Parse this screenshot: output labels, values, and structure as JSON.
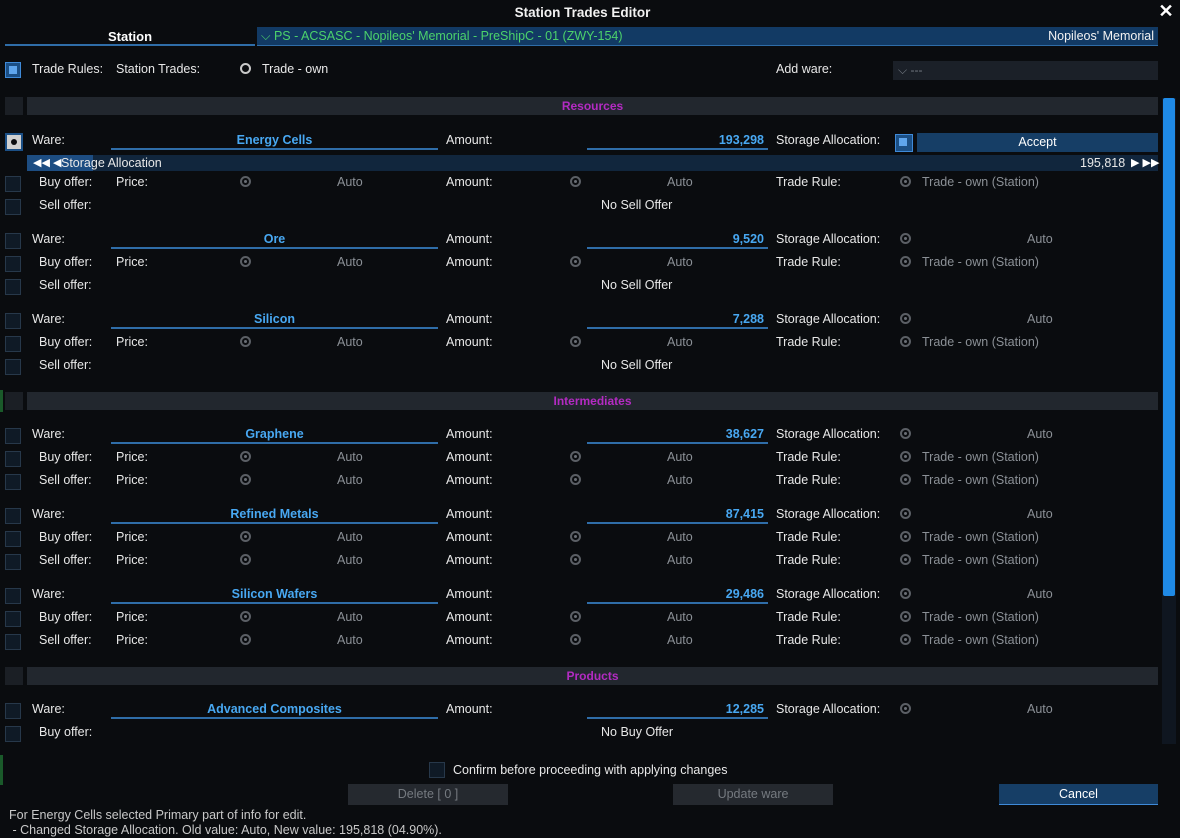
{
  "window": {
    "title": "Station Trades Editor"
  },
  "header": {
    "tab_station": "Station",
    "station_name": "PS - ACSASC - Nopileos' Memorial - PreShipC - 01 (ZWY-154)",
    "station_short": "Nopileos' Memorial"
  },
  "toolbar": {
    "trade_rules_label": "Trade Rules:",
    "station_trades_label": "Station Trades:",
    "trade_own": "Trade - own",
    "add_ware_label": "Add ware:",
    "add_ware_value": "---"
  },
  "labels": {
    "ware": "Ware:",
    "buy_offer": "Buy offer:",
    "sell_offer": "Sell offer:",
    "price": "Price:",
    "amount": "Amount:",
    "storage_allocation": "Storage Allocation:",
    "trade_rule": "Trade Rule:",
    "auto": "Auto",
    "trade_rule_value": "Trade - own (Station)",
    "no_sell_offer": "No Sell Offer",
    "no_buy_offer": "No Buy Offer",
    "accept": "Accept"
  },
  "slider": {
    "label": "Storage Allocation",
    "value": "195,818",
    "fraction": 0.049
  },
  "sections": {
    "resources": "Resources",
    "intermediates": "Intermediates",
    "products": "Products"
  },
  "wares": [
    {
      "name": "Energy Cells",
      "amount": "193,298"
    },
    {
      "name": "Ore",
      "amount": "9,520"
    },
    {
      "name": "Silicon",
      "amount": "7,288"
    },
    {
      "name": "Graphene",
      "amount": "38,627"
    },
    {
      "name": "Refined Metals",
      "amount": "87,415"
    },
    {
      "name": "Silicon Wafers",
      "amount": "29,486"
    },
    {
      "name": "Advanced Composites",
      "amount": "12,285"
    }
  ],
  "footer": {
    "confirm_label": "Confirm before proceeding with applying changes",
    "delete_label": "Delete [ 0 ]",
    "update_label": "Update ware",
    "cancel_label": "Cancel",
    "status_line1": "For Energy Cells selected Primary part of info for edit.",
    "status_line2": " - Changed Storage Allocation. Old value: Auto, New value: 195,818 (04.90%)."
  },
  "colors": {
    "accent": "#3f8edb",
    "section": "#b32bc2",
    "ware": "#48a8f2",
    "station_green": "#4cd26b"
  }
}
